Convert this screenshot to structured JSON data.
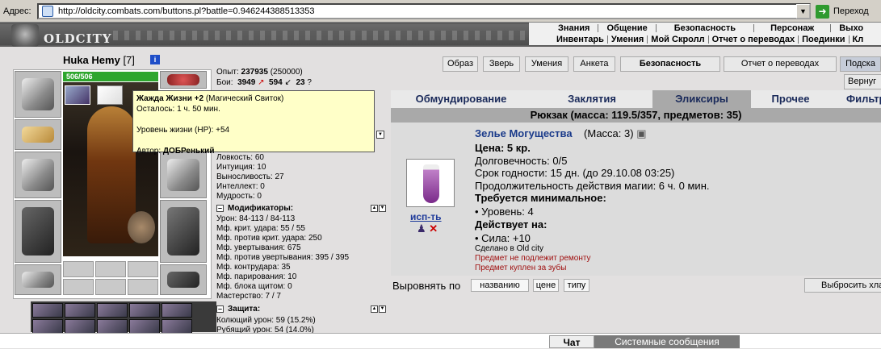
{
  "browser": {
    "address_label": "Адрес:",
    "url": "http://oldcity.combats.com/buttons.pl?battle=0.946244388513353",
    "go_label": "Переход"
  },
  "header": {
    "logo": "OLDCITY",
    "menu_top": [
      "Знания",
      "Общение",
      "Безопасность",
      "Персонаж",
      "Выхо"
    ],
    "menu_bottom": [
      "Инвентарь",
      "Умения",
      "Мой Скролл",
      "Отчет о переводах",
      "Поединки",
      "Кл"
    ]
  },
  "character": {
    "name": "Huka Hemy",
    "level": "[7]",
    "hp": "506/506"
  },
  "stats": {
    "exp_label": "Опыт:",
    "exp_value": "237935",
    "exp_next": "(250000)",
    "fights_label": "Бои:",
    "wins": "3949",
    "losses": "594",
    "draws": "23",
    "agility": "Ловкость: 60",
    "intuition": "Интуиция: 10",
    "endurance": "Выносливость: 27",
    "intellect": "Интеллект: 0",
    "wisdom": "Мудрость: 0",
    "modifiers_title": "Модификаторы:",
    "damage": "Урон: 84-113 / 84-113",
    "crit": "Мф. крит. удара: 55 / 55",
    "anticrit": "Мф. против крит. удара: 250",
    "dodge": "Мф. увертывания: 675",
    "antidodge": "Мф. против увертывания: 395 / 395",
    "counter": "Мф. контрудара: 35",
    "parry": "Мф. парирования: 10",
    "block": "Мф. блока щитом: 0",
    "mastery": "Мастерство: 7 / 7",
    "defense_title": "Защита:",
    "pierce": "Колющий урон: 59 (15.2%)",
    "cut": "Рубящий урон: 54 (14.0%)"
  },
  "tooltip": {
    "title": "Жажда Жизни +2",
    "type": "(Магический Свиток)",
    "remaining": "Осталось: 1 ч. 50 мин.",
    "hp": "Уровень жизни (HP): +54",
    "author_label": "Автор:",
    "author": "ДОБРенький"
  },
  "top_buttons": [
    "Образ",
    "Зверь",
    "Умения",
    "Анкета",
    "Безопасность",
    "Отчет о переводах",
    "Подска"
  ],
  "return_btn": "Вернуг",
  "tabs": [
    "Обмундирование",
    "Заклятия",
    "Эликсиры",
    "Прочее",
    "Фильтр"
  ],
  "inventory_title": "Рюкзак (масса: 119.5/357, предметов: 35)",
  "item": {
    "name": "Зелье Могущества",
    "mass": "(Масса: 3)",
    "price": "Цена: 5 кр.",
    "durability": "Долговечность: 0/5",
    "expiry": "Срок годности: 15 дн. (до 29.10.08 03:25)",
    "duration": "Продолжительность действия магии: 6 ч. 0 мин.",
    "req_title": "Требуется минимальное:",
    "req_level": "• Уровень: 4",
    "effect_title": "Действует на:",
    "effect_str": "• Сила: +10",
    "made": "Сделано в Old city",
    "norepair": "Предмет не подлежит ремонту",
    "teeth": "Предмет куплен за зубы",
    "use_label": "исп-ть"
  },
  "sort": {
    "label": "Выровнять по",
    "by_name": "названию",
    "by_price": "цене",
    "by_type": "типу",
    "drop": "Выбросить хла"
  },
  "chat": {
    "chat_tab": "Чат",
    "system_tab": "Системные сообщения"
  }
}
